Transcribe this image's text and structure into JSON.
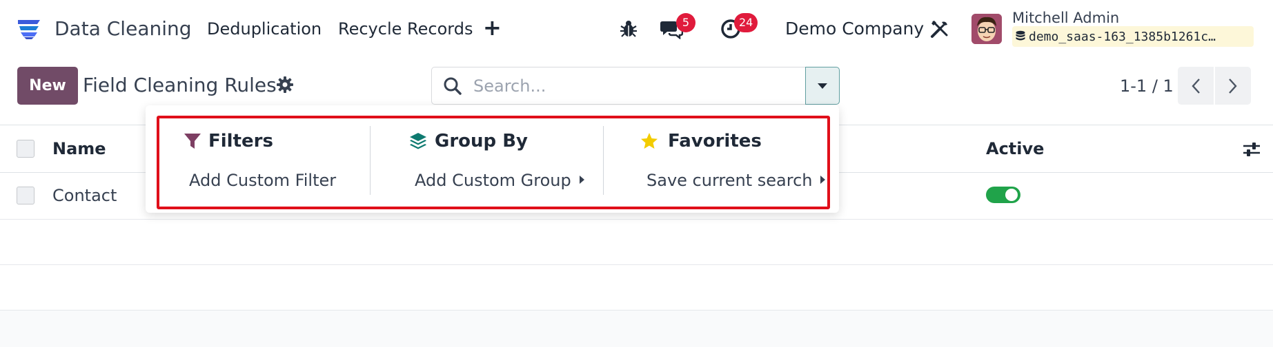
{
  "navbar": {
    "app_name": "Data Cleaning",
    "menu": [
      "Deduplication",
      "Recycle Records"
    ],
    "add_menu_symbol": "+",
    "messages_badge": "5",
    "activities_badge": "24",
    "company": "Demo Company",
    "user_name": "Mitchell Admin",
    "database": "demo_saas-163_1385b1261c…"
  },
  "control_panel": {
    "new_button": "New",
    "title": "Field Cleaning Rules",
    "search_placeholder": "Search...",
    "pager": "1-1 / 1"
  },
  "list": {
    "columns": [
      "Name",
      "Active"
    ],
    "rows": [
      {
        "name": "Contact",
        "active": true
      }
    ]
  },
  "search_panel": {
    "filters": {
      "title": "Filters",
      "items": [
        "Add Custom Filter"
      ]
    },
    "group_by": {
      "title": "Group By",
      "items": [
        "Add Custom Group"
      ]
    },
    "favorites": {
      "title": "Favorites",
      "items": [
        "Save current search"
      ]
    }
  },
  "colors": {
    "brand": "#714b67",
    "badge": "#e01b3c",
    "toggle_on": "#20a34a",
    "highlight": "#e00f1a",
    "favorites_star": "#f3cc00",
    "group_by_icon": "#0e7a70"
  }
}
